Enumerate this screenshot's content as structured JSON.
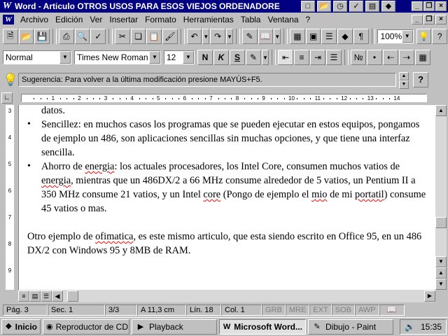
{
  "window": {
    "title": "Word - Articulo OTROS USOS PARA ESOS VIEJOS ORDENADORE",
    "app_icon": "W"
  },
  "menu": {
    "items": [
      "Archivo",
      "Edición",
      "Ver",
      "Insertar",
      "Formato",
      "Herramientas",
      "Tabla",
      "Ventana",
      "?"
    ]
  },
  "toolbar": {
    "zoom": "100%"
  },
  "format": {
    "style": "Normal",
    "font": "Times New Roman",
    "size": "12",
    "bold": "N",
    "italic": "K",
    "underline": "S"
  },
  "tip": {
    "text": "Sugerencia: Para volver a la última modificación presione MAYÚS+F5.",
    "help": "?"
  },
  "ruler": {
    "numbers": [
      "1",
      "2",
      "3",
      "4",
      "5",
      "6",
      "7",
      "8",
      "9",
      "10",
      "11",
      "12",
      "13",
      "14"
    ],
    "side_numbers": [
      "3",
      "4",
      "5",
      "6",
      "7",
      "8",
      "9"
    ]
  },
  "document": {
    "line0": "datos.",
    "bullet1": "Sencillez: en muchos casos los programas que se pueden ejecutar en estos equipos, pongamos de ejemplo un 486, son aplicaciones sencillas sin muchas opciones, y que tiene una interfaz sencilla.",
    "bullet2_a": "Ahorro de ",
    "bullet2_b": "energia",
    "bullet2_c": ": los actuales procesadores, los Intel Core, consumen muchos vatios de ",
    "bullet2_d": "energia",
    "bullet2_e": ", mientras que un 486DX/2 a 66 MHz consume alrededor de 5 vatios, un Pentium II a 350 MHz consume 21 vatios, y un Intel ",
    "bullet2_f": "core",
    "bullet2_g": " (Pongo de ejemplo el ",
    "bullet2_h": "mio",
    "bullet2_i": " de mi ",
    "bullet2_j": "portatil",
    "bullet2_k": ") consume 45 vatios o mas.",
    "para_a": "Otro ejemplo de ",
    "para_b": "ofimatica",
    "para_c": ", es este mismo articulo, que esta siendo escrito en Office 95, en un 486 DX/2 con Windows 95 y 8MB de RAM."
  },
  "status": {
    "page": "Pág. 3",
    "section": "Sec. 1",
    "pages": "3/3",
    "position": "A 11,3 cm",
    "line": "Lín. 18",
    "column": "Col. 1",
    "modes": [
      "GRB",
      "MRE",
      "EXT",
      "SOB",
      "AWP"
    ]
  },
  "taskbar": {
    "start": "Inicio",
    "tasks": [
      "Reproductor de CD",
      "Playback",
      "Microsoft Word...",
      "Dibujo - Paint"
    ],
    "clock": "15:35"
  }
}
